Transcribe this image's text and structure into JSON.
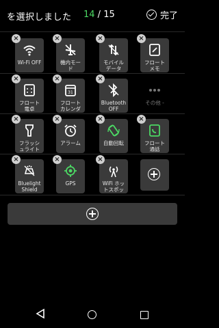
{
  "header": {
    "title": "を選択しました",
    "selected": "14",
    "separator": " / ",
    "total": "15",
    "done_label": "完了"
  },
  "tiles": [
    {
      "label": "Wi-Fi OFF",
      "icon": "wifi-off-icon"
    },
    {
      "label": "機内モー\nド",
      "icon": "airplane-mode-icon"
    },
    {
      "label": "モバイル\nデータ",
      "icon": "mobile-data-icon"
    },
    {
      "label": "フロート\nメモ",
      "icon": "float-memo-icon"
    },
    {
      "label": "フロート\n電卓",
      "icon": "float-calculator-icon"
    },
    {
      "label": "フロート\nカレンダ",
      "icon": "float-calendar-icon"
    },
    {
      "label": "Bluetooth\nOFF",
      "icon": "bluetooth-off-icon"
    },
    {
      "label": "その他 -",
      "icon": "more-dots-icon"
    },
    {
      "label": "フラッシ\nュライト",
      "icon": "flashlight-icon"
    },
    {
      "label": "アラーム",
      "icon": "alarm-icon"
    },
    {
      "label": "自動回転",
      "icon": "auto-rotate-icon"
    },
    {
      "label": "フロート\n通話",
      "icon": "float-call-icon"
    },
    {
      "label": "Bluelight\nShield",
      "icon": "bluelight-shield-icon"
    },
    {
      "label": "GPS",
      "icon": "gps-icon"
    },
    {
      "label": "WiFi ホッ\nトスポッ",
      "icon": "wifi-hotspot-icon"
    }
  ],
  "colors": {
    "accent_green": "#4cd964",
    "background": "#000000",
    "tile": "#3a3a3a"
  }
}
